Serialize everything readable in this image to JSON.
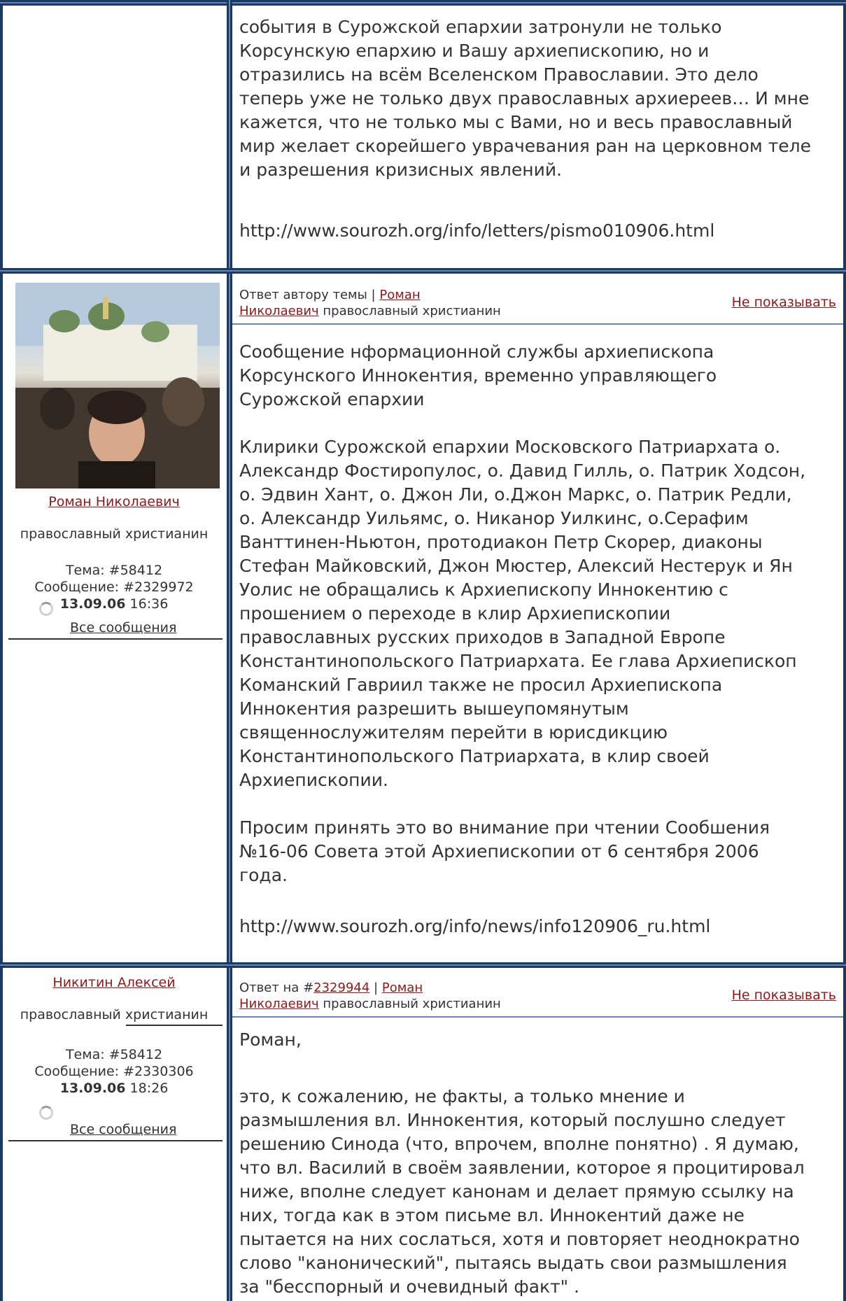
{
  "post1": {
    "body_lines": [
      "события в Сурожской епархии затронули не только",
      "Корсунскую епархию и Вашу архиепископию, но и",
      "отразились на всём Вселенском Православии. Это дело",
      "теперь уже не только двух православных архиереев… И мне",
      "кажется, что не только мы с Вами, но и весь православный",
      "мир желает скорейшего уврачевания ран на церковном теле",
      "и разрешения кризисных явлений."
    ],
    "url": "http://www.sourozh.org/info/letters/pismo010906.html"
  },
  "post2": {
    "author_name": "Роман Николаевич",
    "author_status": "православный христианин",
    "topic": "Тема: #58412",
    "message": "Сообщение: #2329972",
    "date": "13.09.06",
    "time": " 16:36",
    "all_messages": "Все сообщения",
    "header_prefix": "Ответ автору темы | ",
    "header_author_line1": "Роман",
    "header_author_line2": "Николаевич",
    "header_suffix": " православный христианин",
    "hide": "Не показывать",
    "title_lines": [
      "Сообщение нформационной службы архиепископа",
      "Корсунского Иннокентия, временно управляющего",
      "Сурожской епархии"
    ],
    "body_lines": [
      "Клирики Сурожской епархии Московского Патриархата о.",
      "Александр Фостиропулос, о. Давид Гилль, о. Патрик Ходсон,",
      "о. Эдвин Хант, о. Джон Ли, о.Джон Маркс, о. Патрик Редли,",
      "о. Александр Уильямс, о. Никанор Уилкинс, о.Серафим",
      "Ванттинен-Ньютон, протодиакон Петр Скорер, диаконы",
      "Стефан Майковский, Джон Мюстер, Алексий Нестерук и Ян",
      "Уолис не обращались к Архиепископу Иннокентию с",
      "прошением о переходе в клир Архиепископии",
      "православных русских приходов в Западной Европе",
      "Константинопольского Патриархата. Ее глава Архиепископ",
      "Команский Гавриил также не просил Архиепископа",
      "Иннокентия разрешить вышеупомянутым",
      "священнослужителям перейти в юрисдикцию",
      "Константинопольского Патриархата, в клир своей",
      "Архиепископии."
    ],
    "closing_lines": [
      "Просим принять это во внимание при чтении Сообшения",
      "№16-06 Совета этой Архиепископии от 6 сентября 2006",
      "года."
    ],
    "url": "http://www.sourozh.org/info/news/info120906_ru.html"
  },
  "post3": {
    "author_name": "Никитин Алексей",
    "author_status": "православный христианин",
    "topic": "Тема: #58412",
    "message": "Сообщение: #2330306",
    "date": "13.09.06",
    "time": " 18:26",
    "all_messages": "Все сообщения",
    "header_prefix": "Ответ на #",
    "header_reply_id": "2329944",
    "header_sep": " | ",
    "header_author_line1": "Роман",
    "header_author_line2": "Николаевич",
    "header_suffix": " православный христианин",
    "hide": "Не показывать",
    "greeting": "Роман,",
    "body_lines": [
      "это, к сожалению, не факты, а только мнение и",
      "размышления вл. Иннокентия, который послушно следует",
      "решению Синода (что, впрочем, вполне понятно) . Я думаю,",
      "что вл. Василий в своём заявлении, которое я процитировал",
      "ниже, вполне следует канонам и делает прямую ссылку на",
      "них, тогда как в этом письме вл. Иннокентий даже не",
      "пытается на них сослаться, хотя и повторяет неоднократно",
      "слово \"канонический\", пытаясь выдать свои размышления",
      "за \"бесспорный и очевидный факт\" ."
    ]
  }
}
